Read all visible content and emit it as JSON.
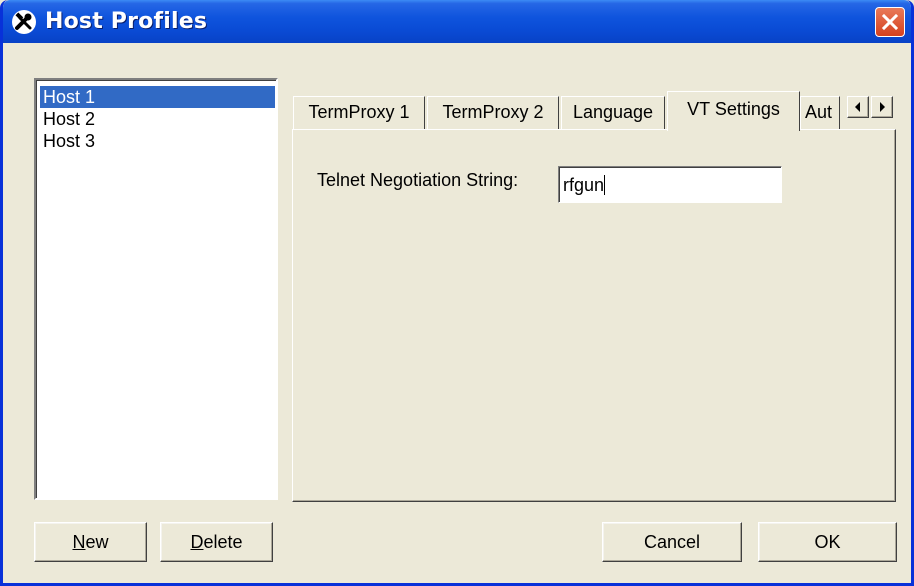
{
  "window": {
    "title": "Host Profiles"
  },
  "hosts": {
    "items": [
      "Host 1",
      "Host 2",
      "Host 3"
    ],
    "selected_index": 0
  },
  "tabs": {
    "items": [
      "TermProxy 1",
      "TermProxy 2",
      "Language",
      "VT Settings",
      "Aut"
    ],
    "active": "VT Settings"
  },
  "vt_settings": {
    "negotiation_label": "Telnet Negotiation String:",
    "negotiation_value": "rfgun"
  },
  "buttons": {
    "new_prefix": "N",
    "new_rest": "ew",
    "delete_prefix": "D",
    "delete_rest": "elete",
    "cancel": "Cancel",
    "ok": "OK"
  },
  "icons": {
    "app": "tools-icon",
    "close": "close-icon",
    "scroll_left": "arrow-left-icon",
    "scroll_right": "arrow-right-icon"
  },
  "colors": {
    "titlebar": "#0a4bd5",
    "selection": "#316ac5",
    "close": "#d4411e",
    "face": "#ece9d8"
  }
}
